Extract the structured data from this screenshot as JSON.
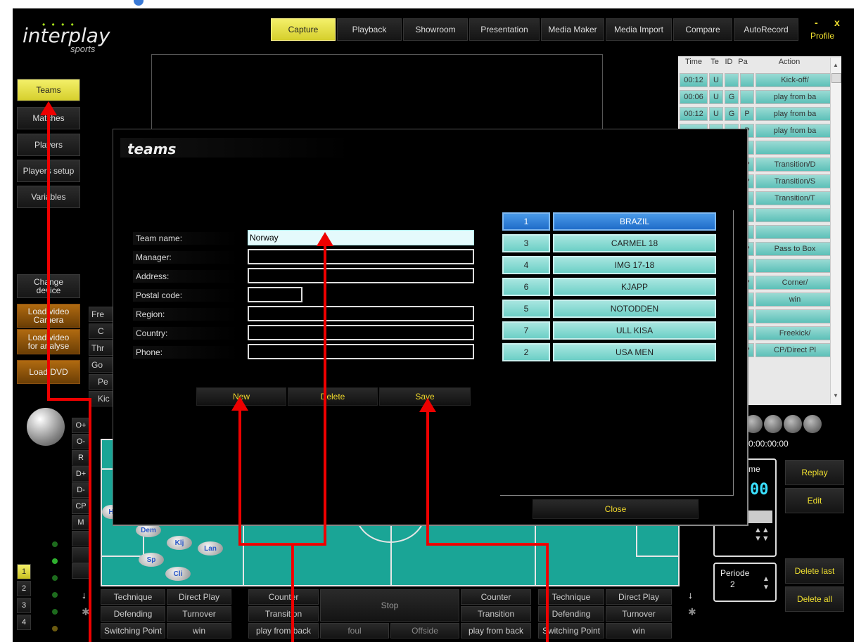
{
  "app": {
    "logo_text": "interplay",
    "logo_sub": "sports"
  },
  "window_controls": {
    "minimize": "-",
    "close": "x",
    "profile": "Profile"
  },
  "top_tabs": [
    {
      "label": "Capture",
      "active": true
    },
    {
      "label": "Playback"
    },
    {
      "label": "Showroom"
    },
    {
      "label": "Presentation"
    },
    {
      "label": "Media Maker"
    },
    {
      "label": "Media Import"
    },
    {
      "label": "Compare"
    },
    {
      "label": "AutoRecord"
    }
  ],
  "left_menu": [
    "Teams",
    "Matches",
    "Players",
    "Players setup",
    "Variables"
  ],
  "left_actions": {
    "change_device": "Change device",
    "load_video_camera": "Load video Camera",
    "load_video_analyse": "Load video for analyse",
    "load_dvd": "Load DVD"
  },
  "hidden_list": [
    "Fre",
    "C",
    "Thr",
    "Go",
    "Pe",
    "Kic"
  ],
  "side_codes": [
    "O+",
    "O-",
    "R",
    "D+",
    "D-",
    "CP",
    "M"
  ],
  "period_buttons": [
    "1",
    "2",
    "3",
    "4"
  ],
  "action_table": {
    "headers": [
      "Time",
      "Te",
      "ID",
      "Pa",
      "Action"
    ],
    "rows": [
      [
        "00:12",
        "U",
        "",
        "",
        "Kick-off/"
      ],
      [
        "00:06",
        "U",
        "G",
        "",
        "play from ba"
      ],
      [
        "00:12",
        "U",
        "G",
        "P",
        "play from ba"
      ],
      [
        "",
        "",
        "",
        "P",
        "play from ba"
      ],
      [
        "",
        "",
        "",
        "",
        ""
      ],
      [
        "",
        "",
        "",
        "P",
        "Transition/D"
      ],
      [
        "",
        "",
        "",
        "P",
        "Transition/S"
      ],
      [
        "",
        "",
        "",
        "",
        "Transition/T"
      ],
      [
        "",
        "",
        "",
        "",
        ""
      ],
      [
        "",
        "",
        "",
        "",
        ""
      ],
      [
        "",
        "",
        "",
        "P",
        "Pass to Box"
      ],
      [
        "",
        "",
        "",
        "",
        ""
      ],
      [
        "",
        "",
        "",
        "P",
        "Corner/"
      ],
      [
        "",
        "",
        "",
        "",
        "win"
      ],
      [
        "",
        "",
        "",
        "",
        ""
      ],
      [
        "",
        "",
        "",
        "",
        "Freekick/"
      ],
      [
        "",
        "",
        "",
        "P",
        "CP/Direct Pl"
      ]
    ]
  },
  "timecode": "0:00:00:00",
  "game_time_label": "me",
  "game_time_value": "00",
  "period": {
    "label": "Periode",
    "value": "2"
  },
  "right_buttons": {
    "replay": "Replay",
    "edit": "Edit",
    "delete_last": "Delete last",
    "delete_all": "Delete all"
  },
  "players_on_field": [
    "H",
    "Dem",
    "Klj",
    "Lan",
    "Sp",
    "Cli"
  ],
  "bottom_left": [
    [
      "Technique",
      "Direct Play"
    ],
    [
      "Defending",
      "Turnover"
    ],
    [
      "Switching Point",
      "win"
    ]
  ],
  "bottom_mid_left": [
    "Counter",
    "Transition",
    "play from back"
  ],
  "bottom_stop": "Stop",
  "bottom_foul": "foul",
  "bottom_offside": "Offside",
  "bottom_mid_right": [
    "Counter",
    "Transition",
    "play from back"
  ],
  "bottom_right": [
    [
      "Technique",
      "Direct Play"
    ],
    [
      "Defending",
      "Turnover"
    ],
    [
      "Switching Point",
      "win"
    ]
  ],
  "teams_dialog": {
    "title": "teams",
    "fields": [
      {
        "label": "Team name:",
        "value": "Norway"
      },
      {
        "label": "Manager:",
        "value": ""
      },
      {
        "label": "Address:",
        "value": ""
      },
      {
        "label": "Postal code:",
        "value": ""
      },
      {
        "label": "Region:",
        "value": ""
      },
      {
        "label": "Country:",
        "value": ""
      },
      {
        "label": "Phone:",
        "value": ""
      }
    ],
    "buttons": {
      "new": "New",
      "delete": "Delete",
      "save": "Save",
      "close": "Close"
    },
    "teams": [
      {
        "id": "1",
        "name": "BRAZIL",
        "selected": true
      },
      {
        "id": "3",
        "name": "CARMEL 18"
      },
      {
        "id": "4",
        "name": "IMG 17-18"
      },
      {
        "id": "6",
        "name": "KJAPP"
      },
      {
        "id": "5",
        "name": "NOTODDEN"
      },
      {
        "id": "7",
        "name": "ULL KISA"
      },
      {
        "id": "2",
        "name": "USA MEN"
      }
    ]
  },
  "colors": {
    "accent_yellow": "#f4f06a",
    "teal": "#6ccfc6",
    "field": "#1aa596",
    "selected_blue": "#1f6cc9",
    "annotation_red": "#e00000"
  }
}
